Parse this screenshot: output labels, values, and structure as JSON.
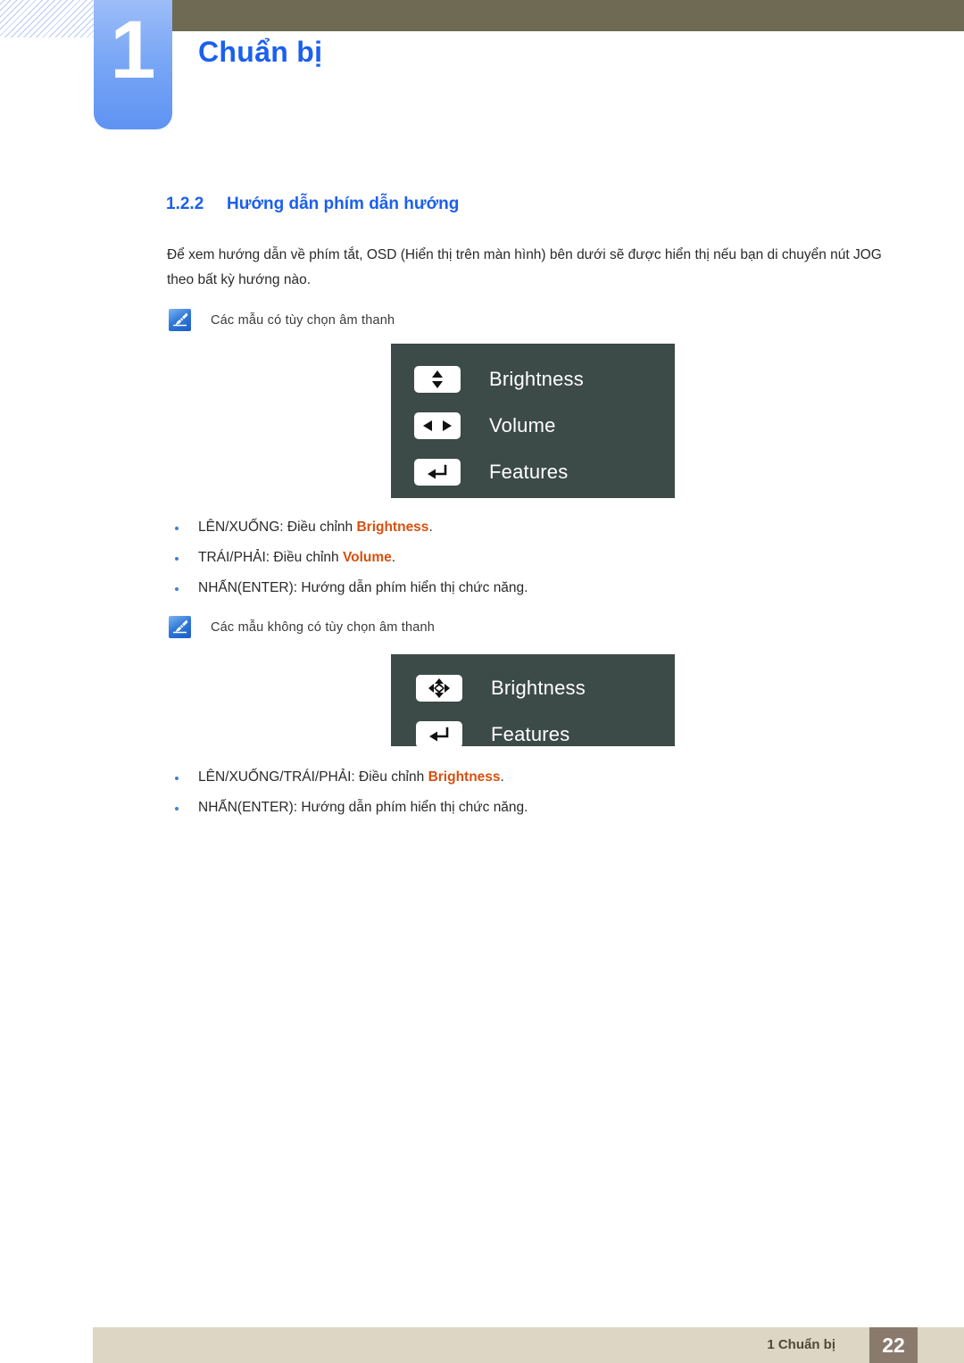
{
  "header": {
    "chapter_number": "1",
    "chapter_title": "Chuẩn bị",
    "accent_color": "#1b5ff0",
    "bar_color": "#6e6a53",
    "tab_color": "#7aa7f6"
  },
  "section": {
    "number": "1.2.2",
    "title": "Hướng dẫn phím dẫn hướng",
    "intro": "Để xem hướng dẫn về phím tắt, OSD (Hiển thị trên màn hình) bên dưới sẽ được hiển thị nếu bạn di chuyển nút JOG theo bất kỳ hướng nào."
  },
  "notes": [
    {
      "icon": "note-pen-icon",
      "text": "Các mẫu có tùy chọn âm thanh"
    },
    {
      "icon": "note-pen-icon",
      "text": "Các mẫu không có tùy chọn âm thanh"
    }
  ],
  "osd_panels": [
    {
      "id": "panel-audio-models",
      "background": "#3c4a48",
      "rows": [
        {
          "icon": "up-down-arrow-icon",
          "label": "Brightness"
        },
        {
          "icon": "left-right-arrow-icon",
          "label": "Volume"
        },
        {
          "icon": "enter-arrow-icon",
          "label": "Features"
        }
      ]
    },
    {
      "id": "panel-no-audio-models",
      "background": "#3c4a48",
      "rows": [
        {
          "icon": "four-way-arrow-icon",
          "label": "Brightness"
        },
        {
          "icon": "enter-arrow-icon",
          "label": "Features"
        }
      ]
    }
  ],
  "bullet_lists": [
    {
      "id": "list-audio-models",
      "items": [
        {
          "prefix": "LÊN/XUỐNG: Điều chỉnh ",
          "keyword": "Brightness",
          "suffix": "."
        },
        {
          "prefix": "TRÁI/PHẢI: Điều chỉnh ",
          "keyword": "Volume",
          "suffix": "."
        },
        {
          "prefix": "NHẤN(ENTER): Hướng dẫn phím hiển thị chức năng.",
          "keyword": "",
          "suffix": ""
        }
      ]
    },
    {
      "id": "list-no-audio-models",
      "items": [
        {
          "prefix": "LÊN/XUỐNG/TRÁI/PHẢI: Điều chỉnh ",
          "keyword": "Brightness",
          "suffix": "."
        },
        {
          "prefix": "NHẤN(ENTER): Hướng dẫn phím hiển thị chức năng.",
          "keyword": "",
          "suffix": ""
        }
      ]
    }
  ],
  "footer": {
    "label": "1 Chuẩn bị",
    "page_number": "22",
    "bar_color": "#ddd6c4",
    "page_box_color": "#8a7a6d"
  },
  "keyword_color": "#d8500f"
}
